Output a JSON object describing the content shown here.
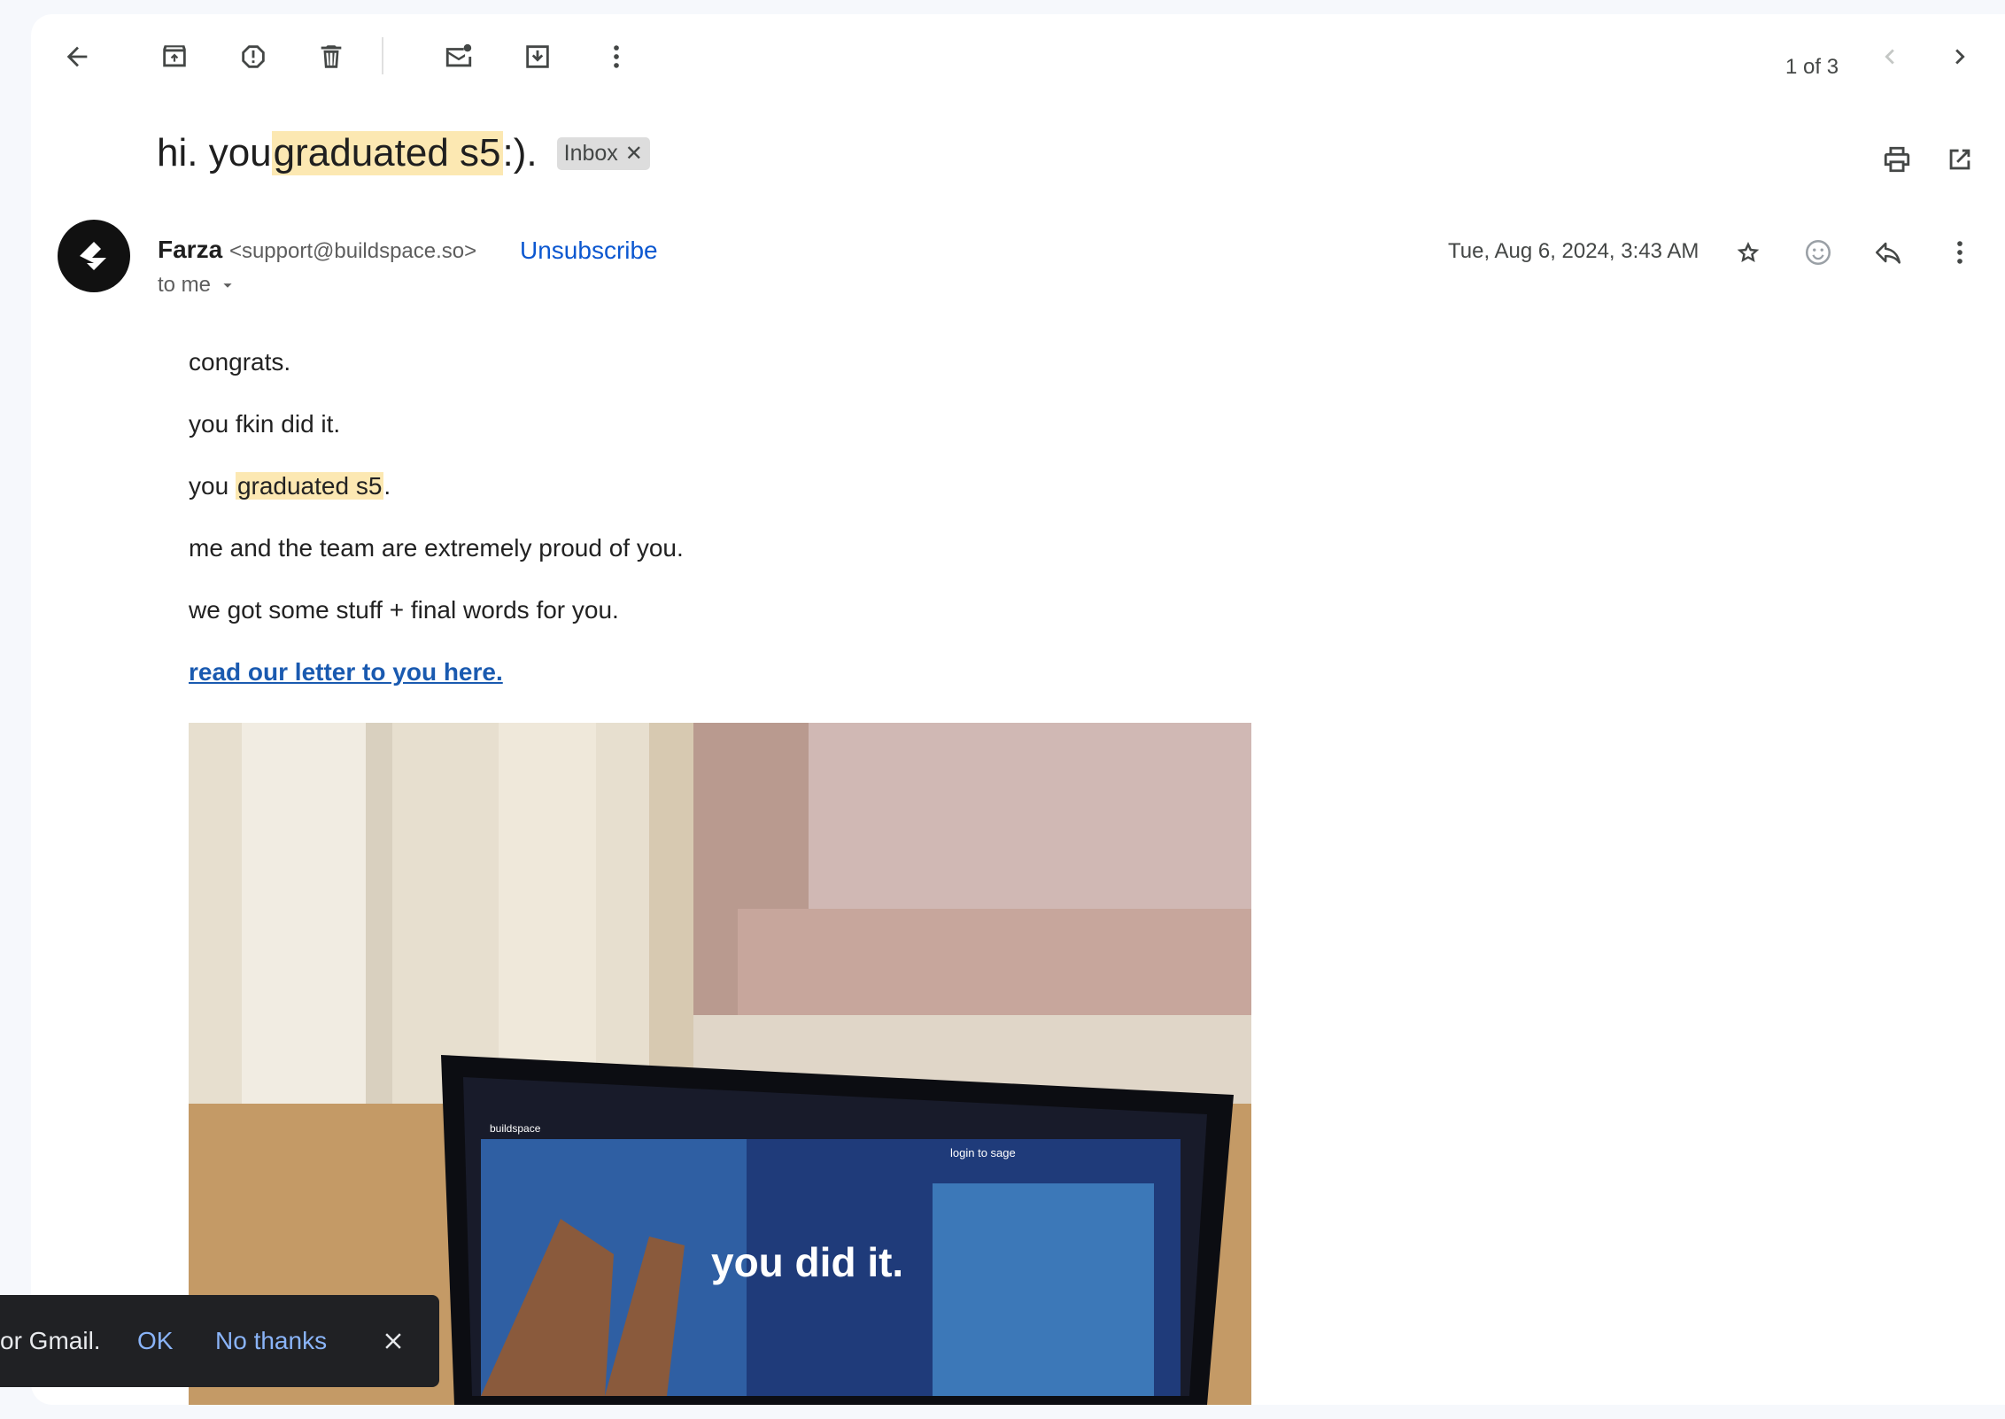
{
  "toolbar": {
    "back_icon": "arrow-left-icon",
    "archive_icon": "archive-icon",
    "spam_icon": "report-spam-icon",
    "delete_icon": "trash-icon",
    "mark_unread_icon": "mark-unread-icon",
    "move_icon": "move-to-icon",
    "more_icon": "more-vert-icon",
    "pager_text": "1 of 3"
  },
  "email": {
    "subject_pre": "hi. you ",
    "subject_hl": "graduated s5",
    "subject_post": " :).",
    "label": "Inbox",
    "sender_name": "Farza",
    "sender_email": "<support@buildspace.so>",
    "unsubscribe": "Unsubscribe",
    "to": "to me",
    "date": "Tue, Aug 6, 2024, 3:43 AM",
    "body": {
      "p1": "congrats.",
      "p2": "you fkin did it.",
      "p3_pre": "you ",
      "p3_hl": "graduated s5",
      "p3_post": ".",
      "p4": "me and the team are extremely proud of you.",
      "p5": "we got some stuff + final words for you.",
      "link": "read our letter to you here."
    },
    "photo": {
      "screen_title": "you did it.",
      "screen_brand": "buildspace",
      "screen_login": "login to sage"
    }
  },
  "toast": {
    "message": "or Gmail.",
    "ok": "OK",
    "no_thanks": "No thanks"
  },
  "colors": {
    "highlight": "#fce8b2",
    "link": "#0b57d0",
    "toast_bg": "#202124"
  }
}
